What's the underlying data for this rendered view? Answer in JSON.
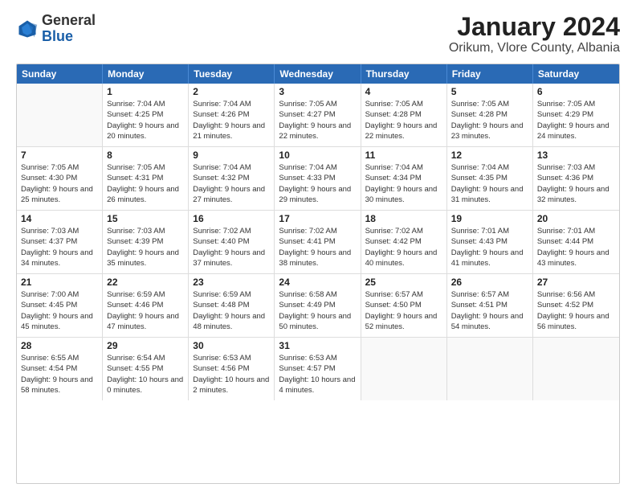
{
  "header": {
    "logo": {
      "general": "General",
      "blue": "Blue"
    },
    "title": "January 2024",
    "subtitle": "Orikum, Vlore County, Albania"
  },
  "days_of_week": [
    "Sunday",
    "Monday",
    "Tuesday",
    "Wednesday",
    "Thursday",
    "Friday",
    "Saturday"
  ],
  "weeks": [
    [
      {
        "day": "",
        "sunrise": "",
        "sunset": "",
        "daylight": ""
      },
      {
        "day": "1",
        "sunrise": "Sunrise: 7:04 AM",
        "sunset": "Sunset: 4:25 PM",
        "daylight": "Daylight: 9 hours and 20 minutes."
      },
      {
        "day": "2",
        "sunrise": "Sunrise: 7:04 AM",
        "sunset": "Sunset: 4:26 PM",
        "daylight": "Daylight: 9 hours and 21 minutes."
      },
      {
        "day": "3",
        "sunrise": "Sunrise: 7:05 AM",
        "sunset": "Sunset: 4:27 PM",
        "daylight": "Daylight: 9 hours and 22 minutes."
      },
      {
        "day": "4",
        "sunrise": "Sunrise: 7:05 AM",
        "sunset": "Sunset: 4:28 PM",
        "daylight": "Daylight: 9 hours and 22 minutes."
      },
      {
        "day": "5",
        "sunrise": "Sunrise: 7:05 AM",
        "sunset": "Sunset: 4:28 PM",
        "daylight": "Daylight: 9 hours and 23 minutes."
      },
      {
        "day": "6",
        "sunrise": "Sunrise: 7:05 AM",
        "sunset": "Sunset: 4:29 PM",
        "daylight": "Daylight: 9 hours and 24 minutes."
      }
    ],
    [
      {
        "day": "7",
        "sunrise": "Sunrise: 7:05 AM",
        "sunset": "Sunset: 4:30 PM",
        "daylight": "Daylight: 9 hours and 25 minutes."
      },
      {
        "day": "8",
        "sunrise": "Sunrise: 7:05 AM",
        "sunset": "Sunset: 4:31 PM",
        "daylight": "Daylight: 9 hours and 26 minutes."
      },
      {
        "day": "9",
        "sunrise": "Sunrise: 7:04 AM",
        "sunset": "Sunset: 4:32 PM",
        "daylight": "Daylight: 9 hours and 27 minutes."
      },
      {
        "day": "10",
        "sunrise": "Sunrise: 7:04 AM",
        "sunset": "Sunset: 4:33 PM",
        "daylight": "Daylight: 9 hours and 29 minutes."
      },
      {
        "day": "11",
        "sunrise": "Sunrise: 7:04 AM",
        "sunset": "Sunset: 4:34 PM",
        "daylight": "Daylight: 9 hours and 30 minutes."
      },
      {
        "day": "12",
        "sunrise": "Sunrise: 7:04 AM",
        "sunset": "Sunset: 4:35 PM",
        "daylight": "Daylight: 9 hours and 31 minutes."
      },
      {
        "day": "13",
        "sunrise": "Sunrise: 7:03 AM",
        "sunset": "Sunset: 4:36 PM",
        "daylight": "Daylight: 9 hours and 32 minutes."
      }
    ],
    [
      {
        "day": "14",
        "sunrise": "Sunrise: 7:03 AM",
        "sunset": "Sunset: 4:37 PM",
        "daylight": "Daylight: 9 hours and 34 minutes."
      },
      {
        "day": "15",
        "sunrise": "Sunrise: 7:03 AM",
        "sunset": "Sunset: 4:39 PM",
        "daylight": "Daylight: 9 hours and 35 minutes."
      },
      {
        "day": "16",
        "sunrise": "Sunrise: 7:02 AM",
        "sunset": "Sunset: 4:40 PM",
        "daylight": "Daylight: 9 hours and 37 minutes."
      },
      {
        "day": "17",
        "sunrise": "Sunrise: 7:02 AM",
        "sunset": "Sunset: 4:41 PM",
        "daylight": "Daylight: 9 hours and 38 minutes."
      },
      {
        "day": "18",
        "sunrise": "Sunrise: 7:02 AM",
        "sunset": "Sunset: 4:42 PM",
        "daylight": "Daylight: 9 hours and 40 minutes."
      },
      {
        "day": "19",
        "sunrise": "Sunrise: 7:01 AM",
        "sunset": "Sunset: 4:43 PM",
        "daylight": "Daylight: 9 hours and 41 minutes."
      },
      {
        "day": "20",
        "sunrise": "Sunrise: 7:01 AM",
        "sunset": "Sunset: 4:44 PM",
        "daylight": "Daylight: 9 hours and 43 minutes."
      }
    ],
    [
      {
        "day": "21",
        "sunrise": "Sunrise: 7:00 AM",
        "sunset": "Sunset: 4:45 PM",
        "daylight": "Daylight: 9 hours and 45 minutes."
      },
      {
        "day": "22",
        "sunrise": "Sunrise: 6:59 AM",
        "sunset": "Sunset: 4:46 PM",
        "daylight": "Daylight: 9 hours and 47 minutes."
      },
      {
        "day": "23",
        "sunrise": "Sunrise: 6:59 AM",
        "sunset": "Sunset: 4:48 PM",
        "daylight": "Daylight: 9 hours and 48 minutes."
      },
      {
        "day": "24",
        "sunrise": "Sunrise: 6:58 AM",
        "sunset": "Sunset: 4:49 PM",
        "daylight": "Daylight: 9 hours and 50 minutes."
      },
      {
        "day": "25",
        "sunrise": "Sunrise: 6:57 AM",
        "sunset": "Sunset: 4:50 PM",
        "daylight": "Daylight: 9 hours and 52 minutes."
      },
      {
        "day": "26",
        "sunrise": "Sunrise: 6:57 AM",
        "sunset": "Sunset: 4:51 PM",
        "daylight": "Daylight: 9 hours and 54 minutes."
      },
      {
        "day": "27",
        "sunrise": "Sunrise: 6:56 AM",
        "sunset": "Sunset: 4:52 PM",
        "daylight": "Daylight: 9 hours and 56 minutes."
      }
    ],
    [
      {
        "day": "28",
        "sunrise": "Sunrise: 6:55 AM",
        "sunset": "Sunset: 4:54 PM",
        "daylight": "Daylight: 9 hours and 58 minutes."
      },
      {
        "day": "29",
        "sunrise": "Sunrise: 6:54 AM",
        "sunset": "Sunset: 4:55 PM",
        "daylight": "Daylight: 10 hours and 0 minutes."
      },
      {
        "day": "30",
        "sunrise": "Sunrise: 6:53 AM",
        "sunset": "Sunset: 4:56 PM",
        "daylight": "Daylight: 10 hours and 2 minutes."
      },
      {
        "day": "31",
        "sunrise": "Sunrise: 6:53 AM",
        "sunset": "Sunset: 4:57 PM",
        "daylight": "Daylight: 10 hours and 4 minutes."
      },
      {
        "day": "",
        "sunrise": "",
        "sunset": "",
        "daylight": ""
      },
      {
        "day": "",
        "sunrise": "",
        "sunset": "",
        "daylight": ""
      },
      {
        "day": "",
        "sunrise": "",
        "sunset": "",
        "daylight": ""
      }
    ]
  ]
}
